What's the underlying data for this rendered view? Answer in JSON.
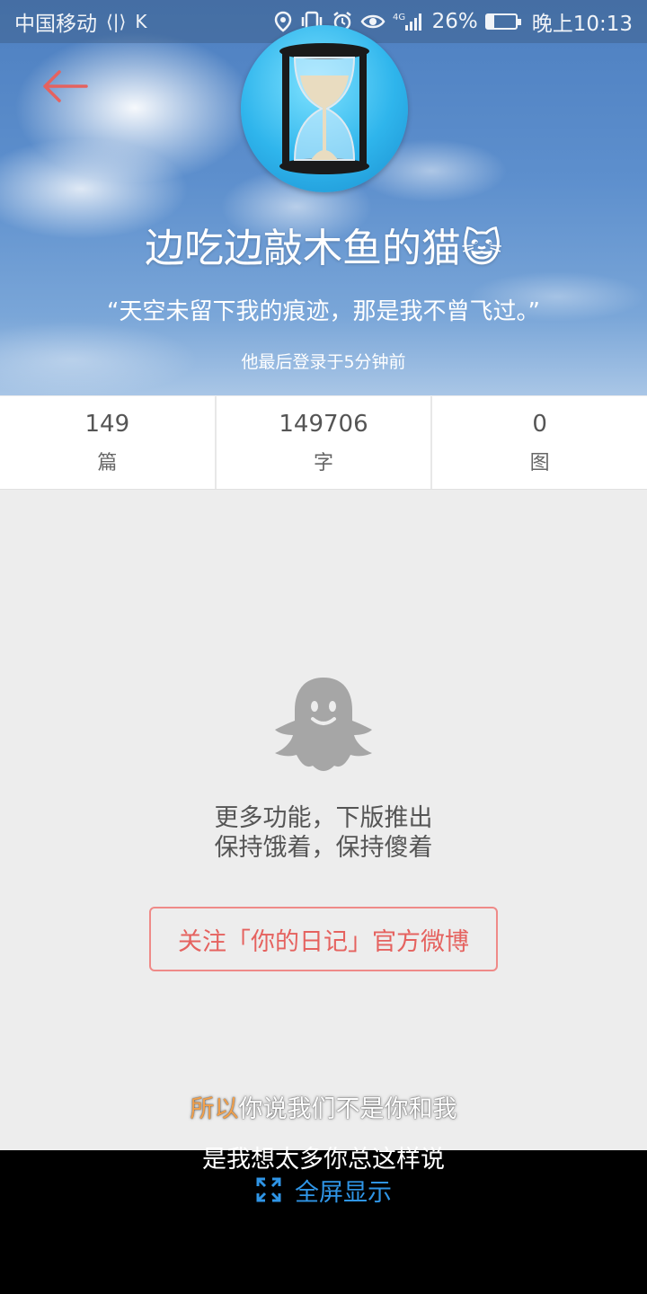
{
  "status_bar": {
    "carrier": "中国移动",
    "battery": "26%",
    "battery_level": 0.26,
    "time": "晚上10:13",
    "icons": [
      "nfc-icon",
      "k-icon",
      "location-icon",
      "vibrate-icon",
      "alarm-icon",
      "eye-icon",
      "4g-signal-icon",
      "battery-icon"
    ]
  },
  "profile": {
    "name": "边吃边敲木鱼的猫😺",
    "motto": "“天空未留下我的痕迹，那是我不曾飞过。”",
    "last_login": "他最后登录于5分钟前",
    "avatar": "hourglass-avatar"
  },
  "stats": [
    {
      "value": "149",
      "label": "篇"
    },
    {
      "value": "149706",
      "label": "字"
    },
    {
      "value": "0",
      "label": "图"
    }
  ],
  "empty_state": {
    "line1": "更多功能，下版推出",
    "line2": "保持饿着，保持傻着",
    "icon": "ghost-icon"
  },
  "follow_button": "关注「你的日记」官方微博",
  "lyrics": {
    "line1_highlight": "所以",
    "line1_rest": "你说我们不是你和我",
    "line2": "是我想太多你总这样说"
  },
  "fullscreen_label": "全屏显示",
  "colors": {
    "accent_red": "#e5625f",
    "link_blue": "#2f95e6",
    "lyric_highlight": "#f2a14c"
  }
}
